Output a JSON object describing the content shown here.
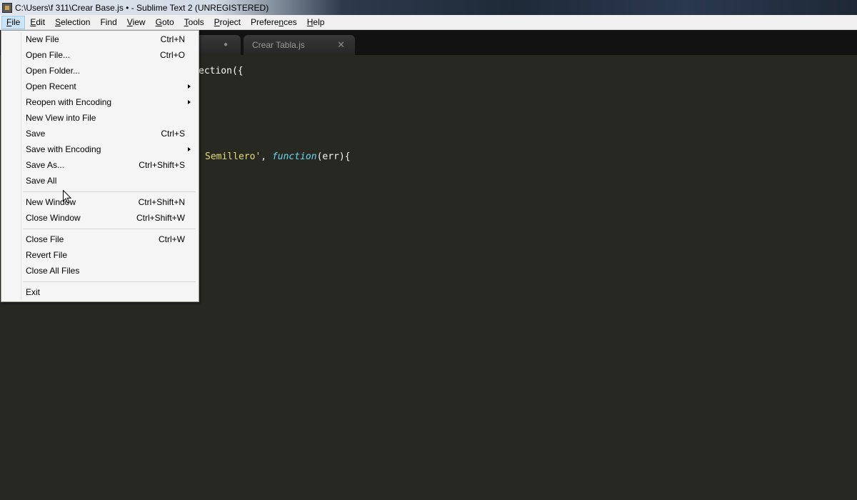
{
  "window": {
    "title": "C:\\Users\\f 311\\Crear Base.js • - Sublime Text 2 (UNREGISTERED)"
  },
  "menubar": {
    "items": [
      {
        "mnemonic": "F",
        "rest": "ile"
      },
      {
        "mnemonic": "E",
        "rest": "dit"
      },
      {
        "mnemonic": "S",
        "rest": "election"
      },
      {
        "mnemonic": "",
        "rest": "Find"
      },
      {
        "mnemonic": "V",
        "rest": "iew"
      },
      {
        "mnemonic": "G",
        "rest": "oto"
      },
      {
        "mnemonic": "T",
        "rest": "ools"
      },
      {
        "mnemonic": "P",
        "rest": "roject"
      },
      {
        "pre": "Prefere",
        "mnemonic": "n",
        "rest": "ces"
      },
      {
        "mnemonic": "H",
        "rest": "elp"
      }
    ]
  },
  "tabs": [
    {
      "label": "",
      "dirty_marker": "●"
    },
    {
      "label": "Crear Tabla.js",
      "close_marker": "✕"
    }
  ],
  "editor": {
    "line_1": "ection({",
    "line_2": {
      "str": "Semillero'",
      "sep": ", ",
      "kw": "function",
      "rest": "(err){"
    }
  },
  "file_menu": {
    "items": [
      {
        "label": "New File",
        "shortcut": "Ctrl+N"
      },
      {
        "label": "Open File...",
        "shortcut": "Ctrl+O"
      },
      {
        "label": "Open Folder...",
        "shortcut": ""
      },
      {
        "label": "Open Recent",
        "shortcut": "",
        "submenu": true
      },
      {
        "label": "Reopen with Encoding",
        "shortcut": "",
        "submenu": true
      },
      {
        "label": "New View into File",
        "shortcut": ""
      },
      {
        "label": "Save",
        "shortcut": "Ctrl+S"
      },
      {
        "label": "Save with Encoding",
        "shortcut": "",
        "submenu": true
      },
      {
        "label": "Save As...",
        "shortcut": "Ctrl+Shift+S"
      },
      {
        "label": "Save All",
        "shortcut": ""
      },
      {
        "label": "New Window",
        "shortcut": "Ctrl+Shift+N"
      },
      {
        "label": "Close Window",
        "shortcut": "Ctrl+Shift+W"
      },
      {
        "label": "Close File",
        "shortcut": "Ctrl+W"
      },
      {
        "label": "Revert File",
        "shortcut": ""
      },
      {
        "label": "Close All Files",
        "shortcut": ""
      },
      {
        "label": "Exit",
        "shortcut": ""
      }
    ]
  },
  "colors": {
    "editor_bg": "#272822",
    "string": "#e6db74",
    "keyword": "#66d9ef",
    "menu_bg": "#f5f5f5"
  }
}
